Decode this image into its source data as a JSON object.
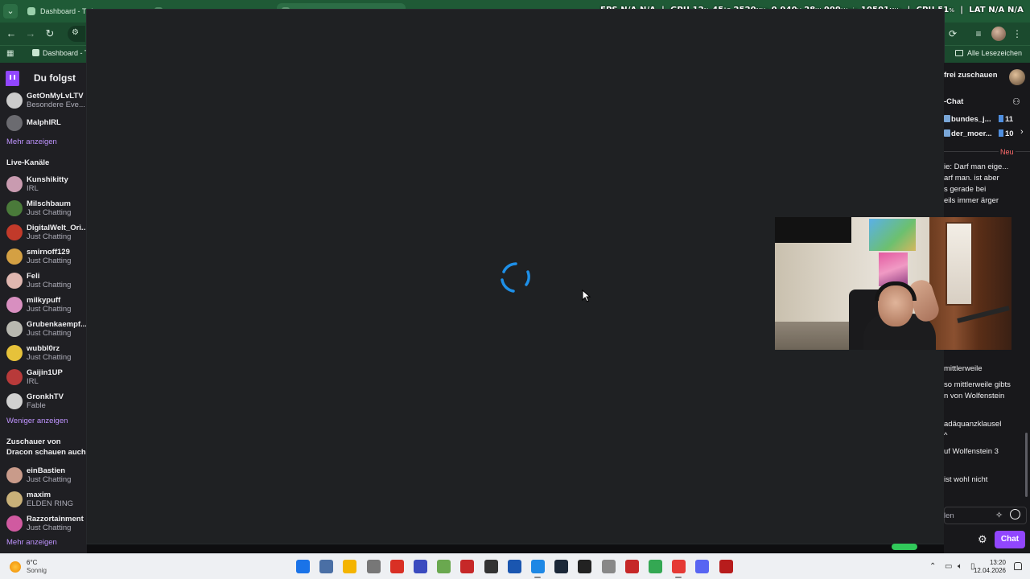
{
  "browser": {
    "tabs": [
      {
        "label": "Dashboard - Twi",
        "active": false
      },
      {
        "label": "",
        "active": false
      },
      {
        "label": "",
        "active": true
      }
    ],
    "bookmark": "Dashboard - Tw",
    "bookmarks_folder": "Alle Lesezeichen"
  },
  "osd": {
    "fps_label": "FPS",
    "fps1": "N/A",
    "fps2": "N/A",
    "gpu_label": "GPU",
    "gpu_load": "12",
    "gpu_temp": "45",
    "gpu_clock": "2520",
    "gpu_volt": "0.940",
    "gpu_power": "28",
    "fan": "999",
    "mem_clock": "10501",
    "cpu_label": "CPU",
    "cpu_load": "51",
    "lat_label": "LAT",
    "lat1": "N/A",
    "lat2": "N/A"
  },
  "sidebar": {
    "title": "Du folgst",
    "followed": [
      {
        "name": "GetOnMyLvLTV",
        "game": "Besondere Eve...",
        "color": "#cccccc"
      },
      {
        "name": "MalphIRL",
        "game": "",
        "color": "#6b6b70"
      }
    ],
    "more1": "Mehr anzeigen",
    "live_title": "Live-Kanäle",
    "live": [
      {
        "name": "Kunshikitty",
        "game": "IRL",
        "color": "#c99bb0"
      },
      {
        "name": "Milschbaum",
        "game": "Just Chatting",
        "color": "#4a7a3a"
      },
      {
        "name": "DigitalWelt_Ori...",
        "game": "Just Chatting",
        "color": "#c23a2a"
      },
      {
        "name": "smirnoff129",
        "game": "Just Chatting",
        "color": "#d4a043"
      },
      {
        "name": "Feli",
        "game": "Just Chatting",
        "color": "#e0b7b0"
      },
      {
        "name": "milkypuff",
        "game": "Just Chatting",
        "color": "#d88fc0"
      },
      {
        "name": "Grubenkaempf...",
        "game": "Just Chatting",
        "color": "#b8b8b0"
      },
      {
        "name": "wubbl0rz",
        "game": "Just Chatting",
        "color": "#e6c23a"
      },
      {
        "name": "Gaijin1UP",
        "game": "IRL",
        "color": "#b83a3a"
      },
      {
        "name": "GronkhTV",
        "game": "Fable",
        "color": "#d0d0d0"
      }
    ],
    "less": "Weniger anzeigen",
    "viewers_title": "Zuschauer von Dracon schauen auch",
    "viewers": [
      {
        "name": "einBastien",
        "game": "Just Chatting",
        "color": "#c99b8a"
      },
      {
        "name": "maxim",
        "game": "ELDEN RING",
        "color": "#c8b078"
      },
      {
        "name": "Razzortainment",
        "game": "Just Chatting",
        "color": "#d05aa0"
      }
    ],
    "more2": "Mehr anzeigen"
  },
  "rightpanel": {
    "top": "frei zuschauen",
    "chat_title": "-Chat",
    "gifters": [
      {
        "name": "bundes_j...",
        "count": "11"
      },
      {
        "name": "der_moer...",
        "count": "10"
      }
    ],
    "new_label": "Neu",
    "messages": [
      "ie: Darf man eige...",
      "arf man. ist aber",
      "s gerade bei",
      "eils immer ärger",
      "mittlerweile",
      "so mittlerweile gibts",
      "n von Wolfenstein",
      "adäquanzklausel",
      "^",
      "uf Wolfenstein 3",
      "ist wohl nicht"
    ],
    "input_placeholder": "len",
    "chat_button": "Chat"
  },
  "taskbar": {
    "temp": "6°C",
    "weather": "Sonnig",
    "time": "13:20",
    "date": "12.04.2026",
    "apps": [
      {
        "name": "windows-start",
        "color": "#1a73e8"
      },
      {
        "name": "calculator",
        "color": "#4a6fa5"
      },
      {
        "name": "file-explorer",
        "color": "#f4b400"
      },
      {
        "name": "mouse-app",
        "color": "#777777"
      },
      {
        "name": "red-bolt-app",
        "color": "#d93025"
      },
      {
        "name": "v-app",
        "color": "#3b4bbf"
      },
      {
        "name": "layers-app",
        "color": "#6aa84f"
      },
      {
        "name": "red-app",
        "color": "#c62828"
      },
      {
        "name": "obs-app",
        "color": "#333333"
      },
      {
        "name": "playstation-app",
        "color": "#1a56b0"
      },
      {
        "name": "pen-app",
        "color": "#1e88e5"
      },
      {
        "name": "steam-app",
        "color": "#1b2838"
      },
      {
        "name": "terminal-app",
        "color": "#222222"
      },
      {
        "name": "settings-app",
        "color": "#888888"
      },
      {
        "name": "voicemod-app",
        "color": "#c62828"
      },
      {
        "name": "chrome-app",
        "color": "#34a853"
      },
      {
        "name": "opera-app",
        "color": "#e53935"
      },
      {
        "name": "discord-app",
        "color": "#5865f2"
      },
      {
        "name": "voicemeeter-app",
        "color": "#b71c1c"
      }
    ]
  }
}
